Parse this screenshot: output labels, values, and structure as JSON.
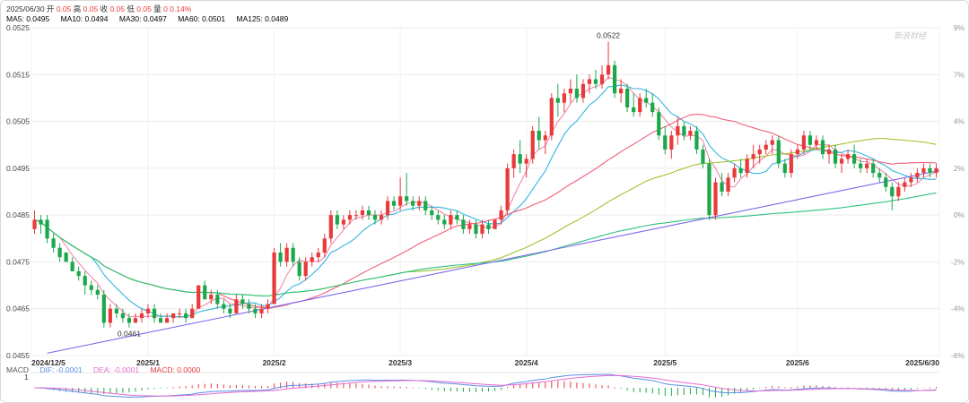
{
  "header": {
    "date": "2025/06/30",
    "open_label": "开",
    "open": "0.05",
    "high_label": "高",
    "high": "0.05",
    "close_label": "收",
    "close": "0.05",
    "low_label": "低",
    "low": "0.05",
    "vol_label": "量",
    "vol": "0",
    "chg": "0.14%"
  },
  "ma_legend": [
    {
      "label": "MA5: 0.0495",
      "color": "#f08aaa"
    },
    {
      "label": "MA10: 0.0494",
      "color": "#34b5df"
    },
    {
      "label": "MA30: 0.0497",
      "color": "#f0607a"
    },
    {
      "label": "MA60: 0.0501",
      "color": "#9fc42e"
    },
    {
      "label": "MA125: 0.0489",
      "color": "#2ec27e"
    }
  ],
  "macd_legend": {
    "title": "MACD",
    "dif": "DIF: -0.0001",
    "dea": "DEA: -0.0001",
    "macd": "MACD: 0.0000"
  },
  "watermark": "新浪财经",
  "colors": {
    "up": "#e83a3a",
    "down": "#1aa84a",
    "trend": "#7b68ee"
  },
  "chart_data": {
    "type": "candlestick",
    "y_ticks": [
      "0.0525",
      "0.0515",
      "0.0505",
      "0.0495",
      "0.0485",
      "0.0475",
      "0.0465",
      "0.0455"
    ],
    "pct_ticks": [
      "9%",
      "7%",
      "4%",
      "2%",
      "0%",
      "-2%",
      "-4%",
      "-6%"
    ],
    "ylim": [
      0.0455,
      0.0525
    ],
    "x_labels": [
      "2024/12/5",
      "2025/1",
      "2025/2",
      "2025/3",
      "2025/4",
      "2025/5",
      "2025/6",
      "2025/6/30"
    ],
    "annotations": [
      {
        "text": "0.0522",
        "date_index": 91,
        "value": 0.0522
      },
      {
        "text": "0.0461",
        "date_index": 15,
        "value": 0.0461
      }
    ],
    "ohlc": [
      [
        0.0482,
        0.0486,
        0.0481,
        0.0484
      ],
      [
        0.0484,
        0.0485,
        0.0481,
        0.0483
      ],
      [
        0.0484,
        0.0485,
        0.0479,
        0.048
      ],
      [
        0.048,
        0.0481,
        0.0477,
        0.0478
      ],
      [
        0.0478,
        0.0479,
        0.0475,
        0.0476
      ],
      [
        0.0477,
        0.0477,
        0.0475,
        0.0475
      ],
      [
        0.0475,
        0.0476,
        0.0473,
        0.0473
      ],
      [
        0.0473,
        0.0474,
        0.0471,
        0.0472
      ],
      [
        0.0472,
        0.0473,
        0.0468,
        0.047
      ],
      [
        0.047,
        0.0471,
        0.0468,
        0.0469
      ],
      [
        0.0469,
        0.047,
        0.0467,
        0.0468
      ],
      [
        0.0468,
        0.0469,
        0.0461,
        0.0462
      ],
      [
        0.0462,
        0.0466,
        0.0461,
        0.0465
      ],
      [
        0.0465,
        0.0466,
        0.0463,
        0.0464
      ],
      [
        0.0464,
        0.0465,
        0.0462,
        0.0463
      ],
      [
        0.0463,
        0.0464,
        0.0461,
        0.0462
      ],
      [
        0.0462,
        0.0464,
        0.0462,
        0.0463
      ],
      [
        0.0463,
        0.0465,
        0.0462,
        0.0464
      ],
      [
        0.0464,
        0.0466,
        0.0463,
        0.0465
      ],
      [
        0.0465,
        0.0466,
        0.0462,
        0.0463
      ],
      [
        0.0463,
        0.0464,
        0.0462,
        0.0462
      ],
      [
        0.0462,
        0.0464,
        0.0462,
        0.0463
      ],
      [
        0.0463,
        0.0464,
        0.0462,
        0.0464
      ],
      [
        0.0464,
        0.0465,
        0.0463,
        0.0464
      ],
      [
        0.0464,
        0.0465,
        0.0462,
        0.0463
      ],
      [
        0.0463,
        0.0466,
        0.0463,
        0.0465
      ],
      [
        0.0465,
        0.047,
        0.0465,
        0.047
      ],
      [
        0.047,
        0.0471,
        0.0467,
        0.0467
      ],
      [
        0.0467,
        0.0469,
        0.0466,
        0.0468
      ],
      [
        0.0468,
        0.0469,
        0.0465,
        0.0466
      ],
      [
        0.0466,
        0.0467,
        0.0464,
        0.0465
      ],
      [
        0.0465,
        0.0466,
        0.0463,
        0.0464
      ],
      [
        0.0464,
        0.0468,
        0.0464,
        0.0467
      ],
      [
        0.0467,
        0.0468,
        0.0465,
        0.0466
      ],
      [
        0.0466,
        0.0467,
        0.0464,
        0.0465
      ],
      [
        0.0465,
        0.0466,
        0.0463,
        0.0464
      ],
      [
        0.0464,
        0.0466,
        0.0463,
        0.0465
      ],
      [
        0.0465,
        0.0467,
        0.0464,
        0.0466
      ],
      [
        0.0466,
        0.0478,
        0.0466,
        0.0477
      ],
      [
        0.0477,
        0.0479,
        0.0474,
        0.0475
      ],
      [
        0.0475,
        0.0479,
        0.0474,
        0.0478
      ],
      [
        0.0478,
        0.0479,
        0.0474,
        0.0475
      ],
      [
        0.0475,
        0.0476,
        0.0471,
        0.0472
      ],
      [
        0.0472,
        0.0476,
        0.0471,
        0.0475
      ],
      [
        0.0475,
        0.0477,
        0.0474,
        0.0476
      ],
      [
        0.0476,
        0.0478,
        0.0475,
        0.0477
      ],
      [
        0.0477,
        0.0481,
        0.0476,
        0.048
      ],
      [
        0.048,
        0.0486,
        0.0479,
        0.0485
      ],
      [
        0.0485,
        0.0486,
        0.0482,
        0.0483
      ],
      [
        0.0483,
        0.0485,
        0.0482,
        0.0484
      ],
      [
        0.0484,
        0.0486,
        0.0483,
        0.0485
      ],
      [
        0.0485,
        0.0486,
        0.0484,
        0.0485
      ],
      [
        0.0485,
        0.0487,
        0.0484,
        0.0486
      ],
      [
        0.0486,
        0.0487,
        0.0484,
        0.0485
      ],
      [
        0.0485,
        0.0486,
        0.0483,
        0.0484
      ],
      [
        0.0484,
        0.0486,
        0.0483,
        0.0485
      ],
      [
        0.0485,
        0.0489,
        0.0484,
        0.0488
      ],
      [
        0.0488,
        0.0489,
        0.0486,
        0.0487
      ],
      [
        0.0487,
        0.0493,
        0.0486,
        0.0489
      ],
      [
        0.0489,
        0.0494,
        0.0487,
        0.0488
      ],
      [
        0.0488,
        0.0489,
        0.0486,
        0.0487
      ],
      [
        0.0487,
        0.0489,
        0.0486,
        0.0488
      ],
      [
        0.0488,
        0.0489,
        0.0485,
        0.0486
      ],
      [
        0.0486,
        0.0487,
        0.0484,
        0.0485
      ],
      [
        0.0485,
        0.0486,
        0.0483,
        0.0484
      ],
      [
        0.0484,
        0.0485,
        0.0482,
        0.0483
      ],
      [
        0.0483,
        0.0486,
        0.0482,
        0.0485
      ],
      [
        0.0485,
        0.0486,
        0.0483,
        0.0484
      ],
      [
        0.0484,
        0.0485,
        0.0481,
        0.0482
      ],
      [
        0.0482,
        0.0484,
        0.0481,
        0.0483
      ],
      [
        0.0483,
        0.0484,
        0.048,
        0.0481
      ],
      [
        0.0481,
        0.0484,
        0.048,
        0.0483
      ],
      [
        0.0483,
        0.0484,
        0.0481,
        0.0482
      ],
      [
        0.0482,
        0.0484,
        0.0482,
        0.0484
      ],
      [
        0.0484,
        0.0487,
        0.0483,
        0.0486
      ],
      [
        0.0486,
        0.0496,
        0.0485,
        0.0495
      ],
      [
        0.0495,
        0.0499,
        0.0493,
        0.0498
      ],
      [
        0.0498,
        0.0501,
        0.0494,
        0.0496
      ],
      [
        0.0496,
        0.0498,
        0.0493,
        0.0497
      ],
      [
        0.0497,
        0.0504,
        0.0496,
        0.0503
      ],
      [
        0.0503,
        0.0506,
        0.0499,
        0.0501
      ],
      [
        0.0501,
        0.0503,
        0.0498,
        0.0502
      ],
      [
        0.0502,
        0.0511,
        0.0501,
        0.051
      ],
      [
        0.051,
        0.0513,
        0.0506,
        0.0509
      ],
      [
        0.0509,
        0.0512,
        0.0507,
        0.0511
      ],
      [
        0.0511,
        0.0514,
        0.0509,
        0.0512
      ],
      [
        0.0512,
        0.0515,
        0.0509,
        0.051
      ],
      [
        0.051,
        0.0514,
        0.0509,
        0.0513
      ],
      [
        0.0513,
        0.0515,
        0.0511,
        0.0514
      ],
      [
        0.0514,
        0.0516,
        0.0512,
        0.0513
      ],
      [
        0.0513,
        0.0517,
        0.0512,
        0.0515
      ],
      [
        0.0515,
        0.0522,
        0.0514,
        0.0517
      ],
      [
        0.0517,
        0.0518,
        0.051,
        0.0511
      ],
      [
        0.0511,
        0.0514,
        0.0509,
        0.0512
      ],
      [
        0.0512,
        0.0513,
        0.0507,
        0.0508
      ],
      [
        0.0508,
        0.0511,
        0.0506,
        0.0507
      ],
      [
        0.0507,
        0.0511,
        0.0506,
        0.051
      ],
      [
        0.051,
        0.0512,
        0.0508,
        0.0509
      ],
      [
        0.0509,
        0.0511,
        0.0506,
        0.0507
      ],
      [
        0.0507,
        0.0508,
        0.0501,
        0.0502
      ],
      [
        0.0502,
        0.0504,
        0.0498,
        0.0499
      ],
      [
        0.0499,
        0.0503,
        0.0497,
        0.0502
      ],
      [
        0.0502,
        0.0506,
        0.05,
        0.0504
      ],
      [
        0.0504,
        0.0505,
        0.0501,
        0.0502
      ],
      [
        0.0502,
        0.0504,
        0.0501,
        0.0503
      ],
      [
        0.0503,
        0.0504,
        0.0498,
        0.0499
      ],
      [
        0.0499,
        0.05,
        0.0495,
        0.0496
      ],
      [
        0.0496,
        0.0497,
        0.0484,
        0.0485
      ],
      [
        0.0485,
        0.0493,
        0.0484,
        0.0492
      ],
      [
        0.0492,
        0.0494,
        0.0489,
        0.049
      ],
      [
        0.049,
        0.0494,
        0.0489,
        0.0493
      ],
      [
        0.0493,
        0.0496,
        0.0492,
        0.0495
      ],
      [
        0.0495,
        0.0497,
        0.0493,
        0.0494
      ],
      [
        0.0494,
        0.0498,
        0.0493,
        0.0497
      ],
      [
        0.0497,
        0.05,
        0.0495,
        0.0498
      ],
      [
        0.0498,
        0.05,
        0.0496,
        0.0499
      ],
      [
        0.0499,
        0.0501,
        0.0498,
        0.05
      ],
      [
        0.05,
        0.0502,
        0.0498,
        0.0501
      ],
      [
        0.0501,
        0.0502,
        0.0495,
        0.0496
      ],
      [
        0.0496,
        0.0497,
        0.0493,
        0.0494
      ],
      [
        0.0494,
        0.0499,
        0.0493,
        0.0498
      ],
      [
        0.0498,
        0.05,
        0.0497,
        0.0499
      ],
      [
        0.0499,
        0.0503,
        0.0498,
        0.0502
      ],
      [
        0.0502,
        0.0503,
        0.0499,
        0.05
      ],
      [
        0.05,
        0.0502,
        0.0499,
        0.0501
      ],
      [
        0.0501,
        0.0502,
        0.0497,
        0.0498
      ],
      [
        0.0498,
        0.05,
        0.0496,
        0.0499
      ],
      [
        0.0499,
        0.05,
        0.0495,
        0.0496
      ],
      [
        0.0496,
        0.0498,
        0.0494,
        0.0497
      ],
      [
        0.0497,
        0.0499,
        0.0496,
        0.0498
      ],
      [
        0.0498,
        0.05,
        0.0495,
        0.0496
      ],
      [
        0.0496,
        0.0497,
        0.0494,
        0.0495
      ],
      [
        0.0495,
        0.0497,
        0.0494,
        0.0496
      ],
      [
        0.0496,
        0.0497,
        0.0493,
        0.0494
      ],
      [
        0.0494,
        0.0495,
        0.0492,
        0.0493
      ],
      [
        0.0493,
        0.0494,
        0.049,
        0.0491
      ],
      [
        0.0491,
        0.0492,
        0.0486,
        0.0489
      ],
      [
        0.0489,
        0.0492,
        0.0488,
        0.0491
      ],
      [
        0.0491,
        0.0493,
        0.049,
        0.0492
      ],
      [
        0.0492,
        0.0494,
        0.0491,
        0.0493
      ],
      [
        0.0493,
        0.0495,
        0.0492,
        0.0494
      ],
      [
        0.0494,
        0.0496,
        0.0493,
        0.0495
      ],
      [
        0.0495,
        0.0496,
        0.0493,
        0.0494
      ],
      [
        0.0494,
        0.0496,
        0.0493,
        0.0495
      ]
    ]
  }
}
